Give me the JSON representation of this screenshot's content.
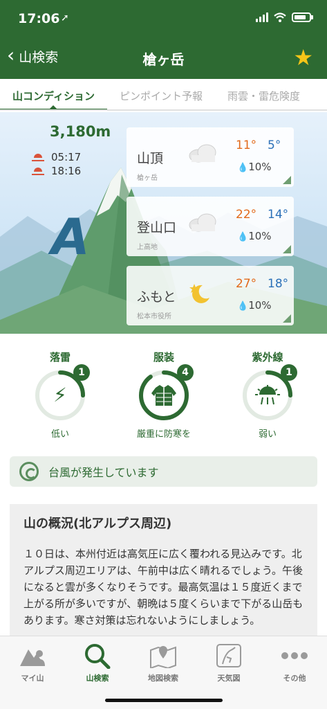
{
  "status_bar": {
    "time": "17:06",
    "location_icon": "location-arrow-icon"
  },
  "nav": {
    "back_label": "山検索",
    "title": "槍ヶ岳",
    "favorite_icon": "star-icon"
  },
  "tabs": [
    {
      "label": "山コンディション",
      "active": true
    },
    {
      "label": "ピンポイント予報",
      "active": false
    },
    {
      "label": "雨雲・雷危険度",
      "active": false
    }
  ],
  "hero": {
    "elevation": "3,180m",
    "sunrise": "05:17",
    "sunset": "18:16",
    "grade_letter": "A"
  },
  "forecast": [
    {
      "name": "山頂",
      "sub": "槍ヶ岳",
      "icon": "cloud-icon",
      "hi": "11°",
      "lo": "5°",
      "rain": "10%"
    },
    {
      "name": "登山口",
      "sub": "上高地",
      "icon": "cloud-icon",
      "hi": "22°",
      "lo": "14°",
      "rain": "10%"
    },
    {
      "name": "ふもと",
      "sub": "松本市役所",
      "icon": "moon-star-icon",
      "hi": "27°",
      "lo": "18°",
      "rain": "10%"
    }
  ],
  "gauges": [
    {
      "title": "落雷",
      "level": "1",
      "status": "低い",
      "icon": "lightning-icon",
      "fill": 0.25
    },
    {
      "title": "服装",
      "level": "4",
      "status": "厳重に防寒を",
      "icon": "jacket-icon",
      "fill": 0.9
    },
    {
      "title": "紫外線",
      "level": "1",
      "status": "弱い",
      "icon": "uv-sun-icon",
      "fill": 0.25
    }
  ],
  "alert": {
    "text": "台風が発生しています",
    "icon": "typhoon-icon"
  },
  "overview": {
    "title": "山の概況(北アルプス周辺)",
    "body": "１０日は、本州付近は高気圧に広く覆われる見込みです。北アルプス周辺エリアは、午前中は広く晴れるでしょう。午後になると雲が多くなりそうです。最高気温は１５度近くまで上がる所が多いですが、朝晩は５度くらいまで下がる山岳もあります。寒さ対策は忘れないようにしましょう。"
  },
  "tabbar": [
    {
      "label": "マイ山",
      "icon": "my-mountain-icon",
      "active": false
    },
    {
      "label": "山検索",
      "icon": "search-icon",
      "active": true
    },
    {
      "label": "地図検索",
      "icon": "map-icon",
      "active": false
    },
    {
      "label": "天気図",
      "icon": "weather-map-icon",
      "active": false
    },
    {
      "label": "その他",
      "icon": "more-icon",
      "active": false
    }
  ],
  "colors": {
    "brand": "#2d6a32",
    "accent_star": "#f5c518",
    "temp_high": "#e26a1b",
    "temp_low": "#2b70b8"
  }
}
